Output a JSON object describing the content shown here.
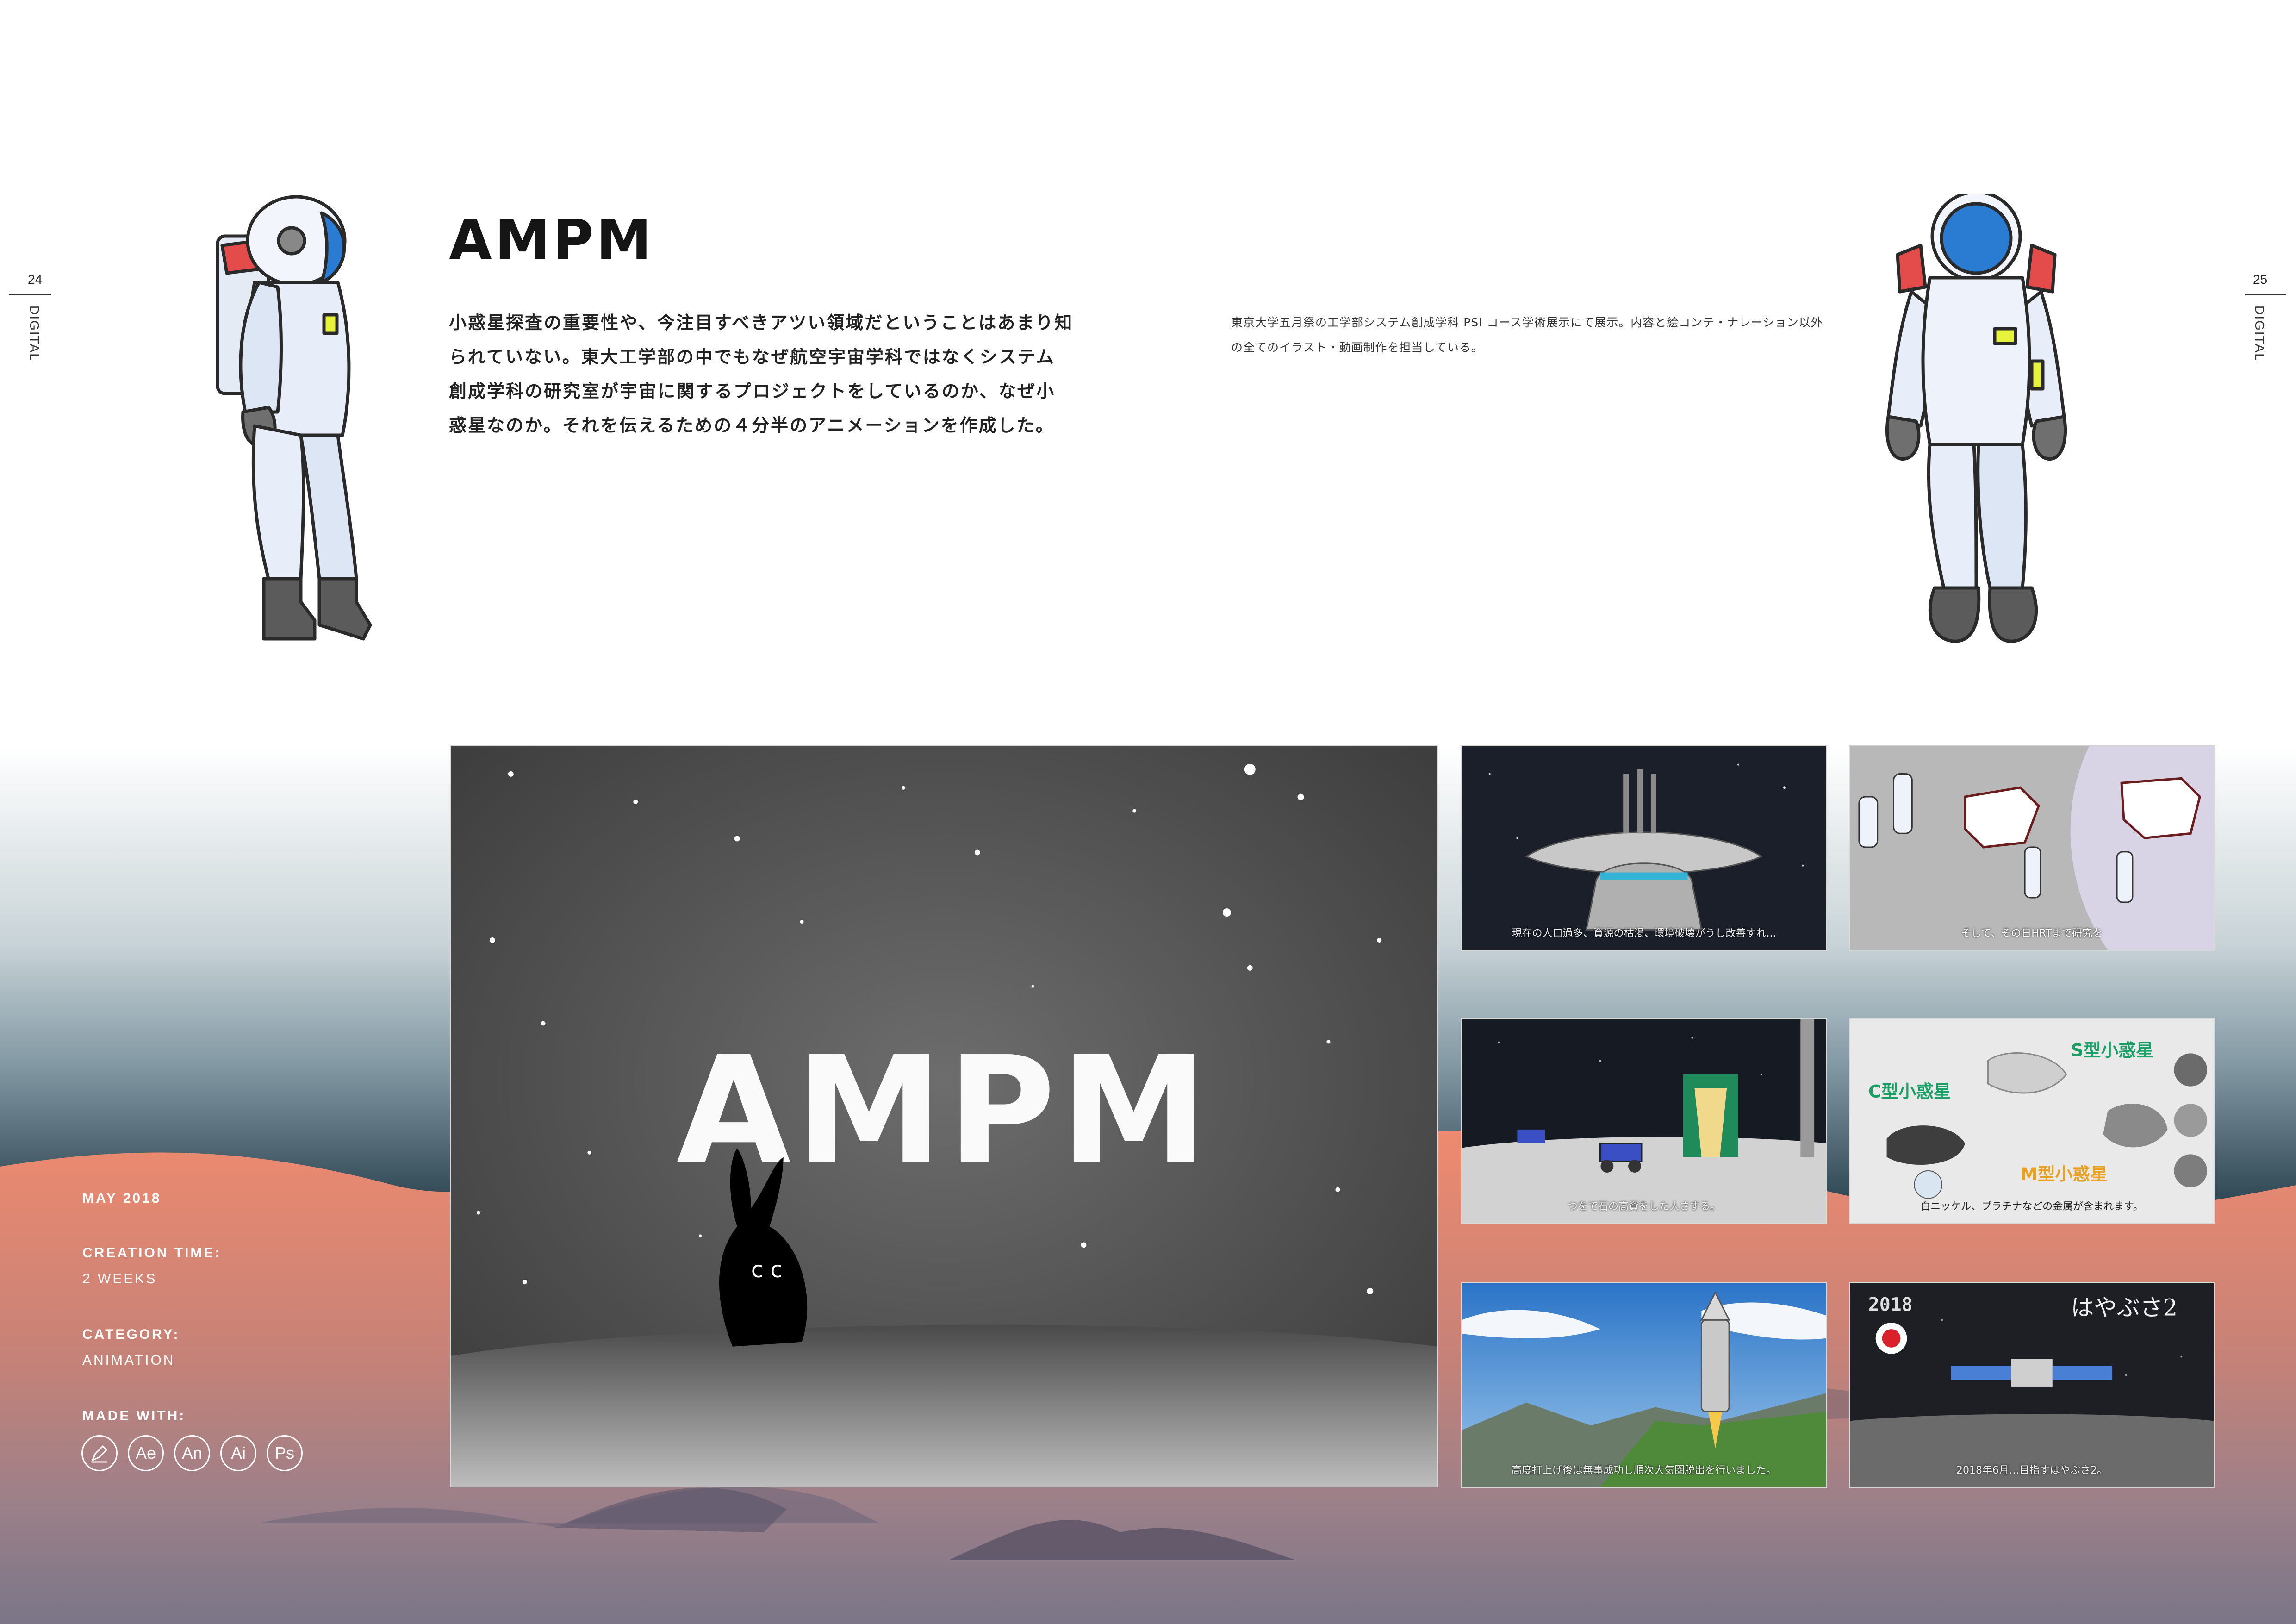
{
  "pages": {
    "left": {
      "number": "24",
      "section": "DIGITAL"
    },
    "right": {
      "number": "25",
      "section": "DIGITAL"
    }
  },
  "project": {
    "title": "AMPM",
    "lead": "小惑星探査の重要性や、今注目すべきアツい領域だということはあまり知られていない。東大工学部の中でもなぜ航空宇宙学科ではなくシステム創成学科の研究室が宇宙に関するプロジェクトをしているのか、なぜ小惑星なのか。それを伝えるための４分半のアニメーションを作成した。",
    "note": "東京大学五月祭の工学部システム創成学科 PSI コース学術展示にて展示。内容と絵コンテ・ナレーション以外の全てのイラスト・動画制作を担当している。"
  },
  "meta": {
    "date": "MAY 2018",
    "creation_label": "CREATION TIME:",
    "creation_value": "2 WEEKS",
    "category_label": "CATEGORY:",
    "category_value": "ANIMATION",
    "made_label": "MADE WITH:",
    "tools": [
      {
        "name": "pen-tool-icon",
        "label": ""
      },
      {
        "name": "after-effects-icon",
        "label": "Ae"
      },
      {
        "name": "animate-icon",
        "label": "An"
      },
      {
        "name": "illustrator-icon",
        "label": "Ai"
      },
      {
        "name": "photoshop-icon",
        "label": "Ps"
      }
    ]
  },
  "stills": {
    "hero_title": "AMPM",
    "f1_caption": "現在の人口過多、資源の枯渇、環境破壊がうし改善すれ...",
    "f2_caption": "そして、その日HRTまで研究を",
    "f3_caption": "つをで石の高資をした人さする。",
    "f4_c_label": "C型小惑星",
    "f4_s_label": "S型小惑星",
    "f4_m_label": "M型小惑星",
    "f4_caption": "白ニッケル、プラチナなどの金属が含まれます。",
    "f5_caption": "高度打上げ後は無事成功し順次大気圏脱出を行いました。",
    "f6_year": "2018",
    "f6_title": "はやぶさ2",
    "f6_caption": "2018年6月…目指すはやぶさ2。"
  },
  "colors": {
    "sky_top": "#ffffff",
    "haze": "#9eb1b9",
    "dusk_teal": "#2f4a58",
    "coral": "#e6836c",
    "mauve": "#9a8088",
    "ground": "#7c7685"
  }
}
